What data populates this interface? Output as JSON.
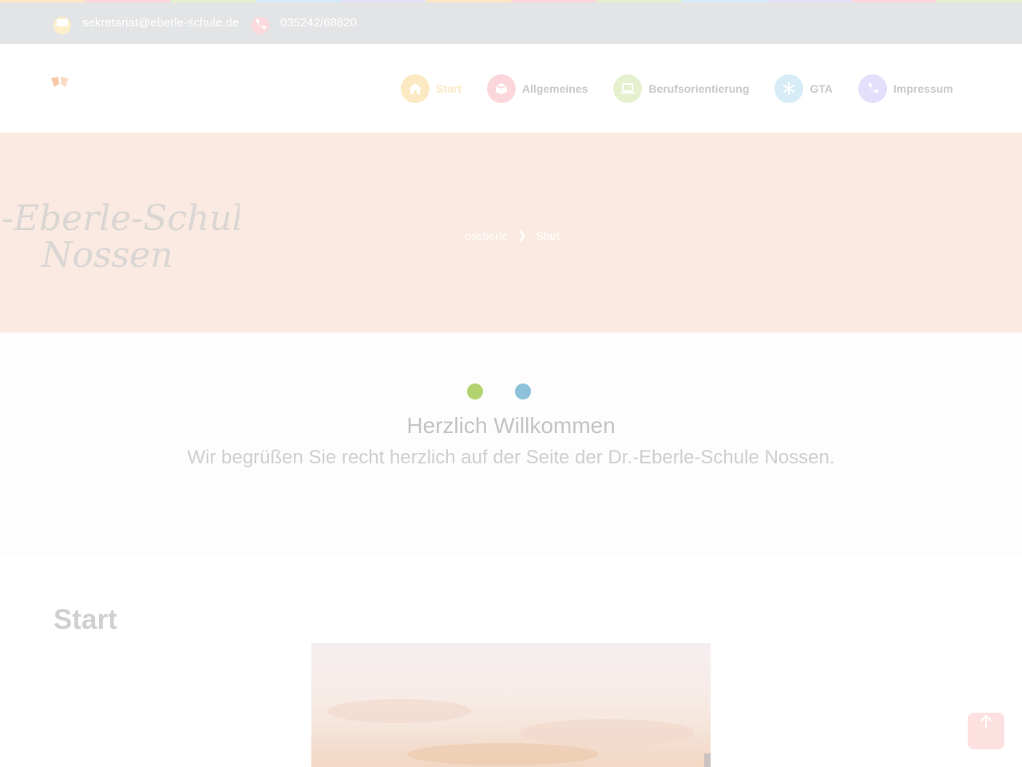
{
  "colors": {
    "strip": [
      "#fbe9c3",
      "#fbd6da",
      "#e5f0cf",
      "#d6ecf7",
      "#e4e0fb",
      "#fbe9c3",
      "#fbd6da",
      "#e5f0cf",
      "#d6ecf7",
      "#e4e0fb",
      "#fbd6da",
      "#e5f0cf"
    ],
    "contact_bar": "#e3e4e6",
    "hero_bg": "#faeae1",
    "dot_green": "#b2d36f",
    "dot_blue": "#8dc1da"
  },
  "contact": {
    "email": "sekretariat@eberle-schule.de",
    "email_icon": "envelope-icon",
    "phone": "035242/68820",
    "phone_icon": "phone-icon"
  },
  "nav": {
    "items": [
      {
        "label": "Start",
        "icon": "home-icon",
        "color": "#fbe9c3",
        "active": true
      },
      {
        "label": "Allgemeines",
        "icon": "box-icon",
        "color": "#fbd6da",
        "active": false
      },
      {
        "label": "Berufsorientierung",
        "icon": "laptop-icon",
        "color": "#e5f0cf",
        "active": false
      },
      {
        "label": "GTA",
        "icon": "asterisk-icon",
        "color": "#d6ecf7",
        "active": false
      },
      {
        "label": "Impressum",
        "icon": "phone-icon",
        "color": "#e4e0fb",
        "active": false
      }
    ]
  },
  "hero": {
    "script_line1": "-Eberle-Schule",
    "script_line2": "Nossen",
    "breadcrumb": {
      "root": "oseberle",
      "separator": "❯",
      "current": "Start"
    }
  },
  "welcome": {
    "title": "Herzlich Willkommen",
    "subtitle": "Wir begrüßen Sie recht herzlich auf der Seite der Dr.-Eberle-Schule Nossen."
  },
  "content": {
    "heading": "Start"
  },
  "back_to_top": {
    "icon": "arrow-up-icon"
  }
}
